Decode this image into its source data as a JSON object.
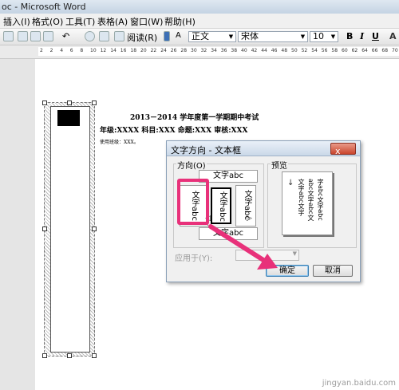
{
  "window": {
    "title": "oc - Microsoft Word"
  },
  "menu": [
    "插入(I)",
    "格式(O)",
    "工具(T)",
    "表格(A)",
    "窗口(W)",
    "帮助(H)"
  ],
  "toolbar": {
    "read_label": "阅读(R)",
    "style_value": "正文",
    "font_value": "宋体",
    "size_value": "10",
    "bold": "B",
    "italic": "I",
    "underline": "U",
    "font_color": "A"
  },
  "ruler": {
    "ticks": [
      "2",
      "2",
      "4",
      "6",
      "8",
      "10",
      "12",
      "14",
      "16",
      "18",
      "20",
      "22",
      "24",
      "26",
      "28",
      "30",
      "32",
      "34",
      "36",
      "38",
      "40",
      "42",
      "44",
      "46",
      "48",
      "50",
      "52",
      "54",
      "56",
      "58",
      "60",
      "62",
      "64",
      "66",
      "68",
      "70"
    ]
  },
  "document": {
    "title": "2013－2014 学年度第一学期期中考试",
    "info_line": "年级:XXXX    科目:XXX    命题:XXX    审核:XXX",
    "sub_line": "使用班级：XXX。"
  },
  "dialog": {
    "title": "文字方向 - 文本框",
    "close": "x",
    "direction_label": "方向(O)",
    "preview_label": "预览",
    "options": {
      "horizontal": "文字abc",
      "vertical_a": "文字abc",
      "vertical_b": "文字abc",
      "vertical_c": "文字abc",
      "bottom": "文字abc"
    },
    "preview_lines": [
      "文字abc文字",
      "abc文字abc文",
      "字abc文字abc"
    ],
    "apply_label": "应用于(Y):",
    "ok": "确定",
    "cancel": "取消"
  },
  "watermark": "jingyan.baidu.com",
  "colors": {
    "highlight": "#e8317a",
    "arrow": "#e8317a"
  }
}
